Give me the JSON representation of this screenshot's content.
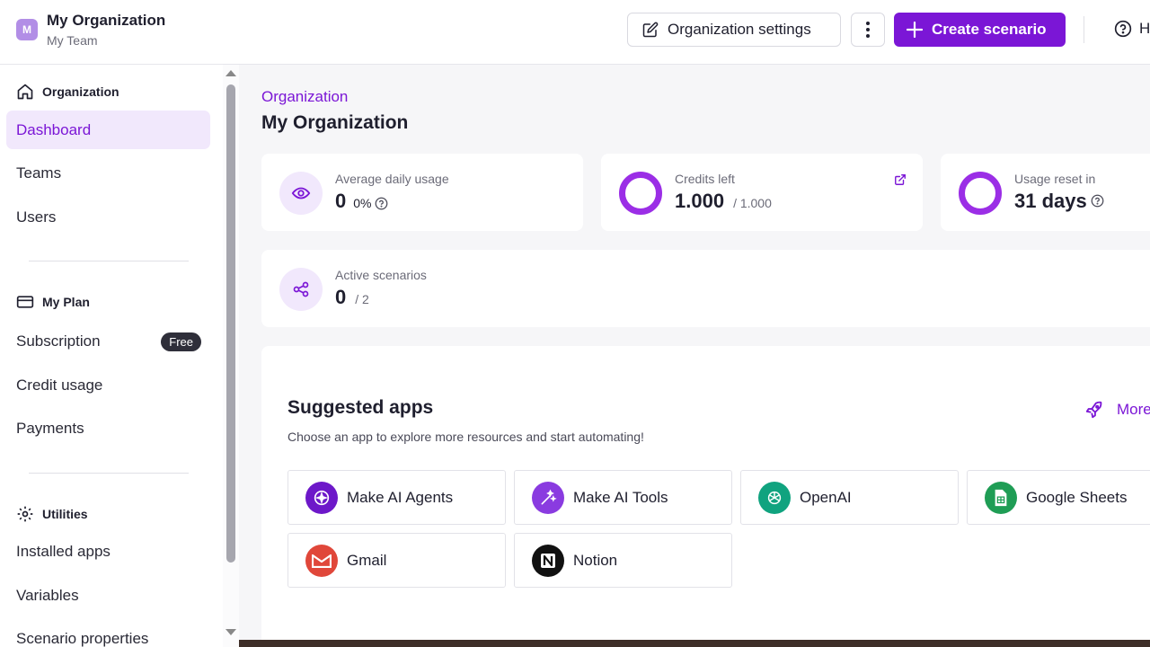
{
  "header": {
    "org_avatar_letter": "M",
    "org_name": "My Organization",
    "team_name": "My Team",
    "settings_label": "Organization settings",
    "create_label": "Create scenario",
    "help_label": "H"
  },
  "sidebar": {
    "sections": {
      "organization": "Organization",
      "my_plan": "My Plan",
      "utilities": "Utilities"
    },
    "items": [
      {
        "label": "Dashboard",
        "active": true
      },
      {
        "label": "Teams"
      },
      {
        "label": "Users"
      },
      {
        "label": "Subscription",
        "badge": "Free"
      },
      {
        "label": "Credit usage"
      },
      {
        "label": "Payments"
      },
      {
        "label": "Installed apps"
      },
      {
        "label": "Variables"
      },
      {
        "label": "Scenario properties"
      }
    ]
  },
  "main": {
    "breadcrumb": "Organization",
    "title": "My Organization",
    "stats": {
      "avg_usage": {
        "label": "Average daily usage",
        "value": "0",
        "sub": "0%"
      },
      "credits": {
        "label": "Credits left",
        "value": "1.000",
        "sub": "/ 1.000"
      },
      "reset": {
        "label": "Usage reset in",
        "value": "31 days"
      },
      "active": {
        "label": "Active scenarios",
        "value": "0",
        "sub": "/ 2"
      }
    },
    "suggested": {
      "title": "Suggested apps",
      "subtitle": "Choose an app to explore more resources and start automating!",
      "more_label": "More",
      "apps": [
        {
          "name": "Make AI Agents",
          "icon": "make-ai-agents-icon",
          "color": "#6d18c9"
        },
        {
          "name": "Make AI Tools",
          "icon": "make-ai-tools-icon",
          "color": "#8a3be0"
        },
        {
          "name": "OpenAI",
          "icon": "openai-icon",
          "color": "#10a37f"
        },
        {
          "name": "Google Sheets",
          "icon": "google-sheets-icon",
          "color": "#1f9d55"
        },
        {
          "name": "Gmail",
          "icon": "gmail-icon",
          "color": "#e0473a"
        },
        {
          "name": "Notion",
          "icon": "notion-icon",
          "color": "#111111"
        }
      ]
    }
  },
  "colors": {
    "accent": "#7b16d6",
    "accent_light": "#f1e8fc"
  }
}
